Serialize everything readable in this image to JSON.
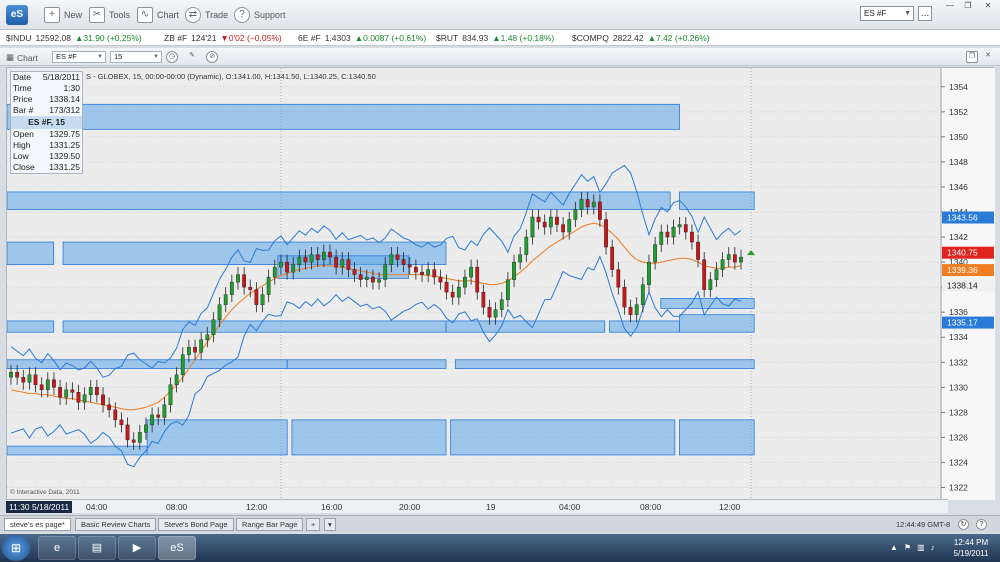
{
  "app": {
    "logo": "eS",
    "toolbar": [
      {
        "label": "New",
        "icon": "new-icon",
        "glyph": "+"
      },
      {
        "label": "Tools",
        "icon": "tools-icon",
        "glyph": "✂"
      },
      {
        "label": "Chart",
        "icon": "chart-icon",
        "glyph": "∿"
      },
      {
        "label": "Trade",
        "icon": "trade-icon",
        "glyph": "⇄"
      },
      {
        "label": "Support",
        "icon": "support-icon",
        "glyph": "?"
      }
    ],
    "symbol_select": "ES #F"
  },
  "ticker": [
    {
      "sym": "$INDU",
      "last": "12592.08",
      "chg": "▲31.90 (+0.25%)",
      "dir": "up"
    },
    {
      "sym": "ZB #F",
      "last": "124'21",
      "chg": "▼0'02 (−0.05%)",
      "dir": "dn"
    },
    {
      "sym": "6E #F",
      "last": "1.4303",
      "chg": "▲0.0087 (+0.61%)",
      "dir": "up"
    },
    {
      "sym": "$RUT",
      "last": "834.93",
      "chg": "▲1.48 (+0.18%)",
      "dir": "up"
    },
    {
      "sym": "$COMPQ",
      "last": "2822.42",
      "chg": "▲7.42 (+0.26%)",
      "dir": "up"
    }
  ],
  "chart_window": {
    "title": "Chart",
    "symbol": "ES #F",
    "interval": "15",
    "description": "S - GLOBEX, 15, 00:00-00:00 (Dynamic), O:1341.00, H:1341.50, L:1340.25, C:1340.50",
    "watermark": "© Interactive Data, 2011"
  },
  "info": {
    "Date": "5/18/2011",
    "Time": "1:30",
    "Price": "1338.14",
    "Bar": "173/312",
    "header": "ES #F, 15",
    "Open": "1329.75",
    "High": "1331.25",
    "Low": "1329.50",
    "Close": "1331.25"
  },
  "chart_data": {
    "type": "candlestick",
    "ylim": [
      1321,
      1355.5
    ],
    "yticks": [
      1322,
      1324,
      1326,
      1328,
      1330,
      1332,
      1334,
      1336,
      1338,
      1340,
      1342,
      1344,
      1346,
      1348,
      1350,
      1352,
      1354
    ],
    "xticks": [
      "04:00",
      "08:00",
      "12:00",
      "16:00",
      "20:00",
      "19",
      "04:00",
      "08:00",
      "12:00"
    ],
    "cursor_time": "11:30 5/18/2011",
    "price_labels": [
      {
        "value": 1343.56,
        "text": "1343.56",
        "color": "#2a7ad8"
      },
      {
        "value": 1340.75,
        "text": "1340.75",
        "color": "#e0241c"
      },
      {
        "value": 1339.36,
        "text": "1339.36",
        "color": "#f07d22"
      },
      {
        "value": 1338.14,
        "text": "1338.14",
        "color": "#f0f0f0"
      },
      {
        "value": 1335.17,
        "text": "1335.17",
        "color": "#2a7ad8"
      }
    ],
    "zones": [
      {
        "x0": 0.0,
        "x1": 0.72,
        "y0": 1350.6,
        "y1": 1352.6
      },
      {
        "x0": 0.0,
        "x1": 0.71,
        "y0": 1344.2,
        "y1": 1345.6
      },
      {
        "x0": 0.72,
        "x1": 0.8,
        "y0": 1344.2,
        "y1": 1345.6
      },
      {
        "x0": 0.0,
        "x1": 0.05,
        "y0": 1339.8,
        "y1": 1341.6
      },
      {
        "x0": 0.06,
        "x1": 0.47,
        "y0": 1339.8,
        "y1": 1341.6
      },
      {
        "x0": 0.29,
        "x1": 0.43,
        "y0": 1338.7,
        "y1": 1340.5
      },
      {
        "x0": 0.7,
        "x1": 0.8,
        "y0": 1336.3,
        "y1": 1337.1
      },
      {
        "x0": 0.0,
        "x1": 0.05,
        "y0": 1334.4,
        "y1": 1335.3
      },
      {
        "x0": 0.06,
        "x1": 0.47,
        "y0": 1334.4,
        "y1": 1335.3
      },
      {
        "x0": 0.47,
        "x1": 0.64,
        "y0": 1334.4,
        "y1": 1335.3
      },
      {
        "x0": 0.645,
        "x1": 0.72,
        "y0": 1334.4,
        "y1": 1335.3
      },
      {
        "x0": 0.72,
        "x1": 0.8,
        "y0": 1334.4,
        "y1": 1335.8
      },
      {
        "x0": 0.0,
        "x1": 0.3,
        "y0": 1331.5,
        "y1": 1332.2
      },
      {
        "x0": 0.3,
        "x1": 0.47,
        "y0": 1331.5,
        "y1": 1332.2
      },
      {
        "x0": 0.48,
        "x1": 0.8,
        "y0": 1331.5,
        "y1": 1332.2
      },
      {
        "x0": 0.15,
        "x1": 0.3,
        "y0": 1324.6,
        "y1": 1327.4
      },
      {
        "x0": 0.305,
        "x1": 0.47,
        "y0": 1324.6,
        "y1": 1327.4
      },
      {
        "x0": 0.475,
        "x1": 0.715,
        "y0": 1324.6,
        "y1": 1327.4
      },
      {
        "x0": 0.72,
        "x1": 0.8,
        "y0": 1324.6,
        "y1": 1327.4
      },
      {
        "x0": 0.0,
        "x1": 0.15,
        "y0": 1324.6,
        "y1": 1325.3
      }
    ],
    "closes": [
      1331.2,
      1330.8,
      1330.4,
      1331.0,
      1330.2,
      1329.8,
      1330.6,
      1330.0,
      1329.2,
      1329.8,
      1329.6,
      1328.8,
      1329.4,
      1330.0,
      1329.4,
      1328.6,
      1328.2,
      1327.4,
      1327.0,
      1325.8,
      1325.6,
      1326.4,
      1327.0,
      1327.8,
      1327.6,
      1328.6,
      1330.2,
      1331.0,
      1332.6,
      1333.2,
      1332.8,
      1333.8,
      1334.2,
      1335.4,
      1336.6,
      1337.4,
      1338.4,
      1339.0,
      1338.0,
      1337.8,
      1336.6,
      1337.4,
      1338.8,
      1339.6,
      1340.0,
      1339.2,
      1339.8,
      1340.4,
      1340.0,
      1340.6,
      1340.2,
      1340.8,
      1340.4,
      1339.6,
      1340.2,
      1339.4,
      1339.0,
      1338.6,
      1338.8,
      1338.4,
      1338.6,
      1339.8,
      1340.6,
      1340.2,
      1339.8,
      1339.6,
      1339.2,
      1339.0,
      1339.4,
      1338.8,
      1338.4,
      1337.6,
      1337.2,
      1338.0,
      1338.8,
      1339.6,
      1337.6,
      1336.4,
      1335.6,
      1336.2,
      1337.0,
      1338.6,
      1340.0,
      1340.6,
      1342.0,
      1343.6,
      1343.2,
      1342.8,
      1343.6,
      1343.0,
      1342.4,
      1343.4,
      1344.2,
      1345.0,
      1344.4,
      1344.8,
      1343.4,
      1341.2,
      1339.4,
      1338.0,
      1336.4,
      1335.8,
      1336.6,
      1338.2,
      1340.0,
      1341.4,
      1342.4,
      1342.0,
      1342.8,
      1343.0,
      1342.4,
      1341.6,
      1340.2,
      1337.8,
      1338.6,
      1339.4,
      1340.2,
      1340.6,
      1340.0,
      1340.4
    ],
    "ma": [
      1329.8,
      1329.7,
      1329.6,
      1329.5,
      1329.5,
      1329.4,
      1329.4,
      1329.3,
      1329.2,
      1329.1,
      1329.1,
      1329.0,
      1328.9,
      1328.8,
      1328.7,
      1328.6,
      1328.5,
      1328.4,
      1328.3,
      1328.2,
      1328.2,
      1328.3,
      1328.4,
      1328.6,
      1328.8,
      1329.2,
      1329.7,
      1330.2,
      1330.8,
      1331.5,
      1332.2,
      1332.9,
      1333.6,
      1334.3,
      1335.0,
      1335.6,
      1336.2,
      1336.7,
      1337.1,
      1337.5,
      1337.8,
      1338.1,
      1338.4,
      1338.7,
      1338.9,
      1339.1,
      1339.3,
      1339.4,
      1339.5,
      1339.6,
      1339.7,
      1339.7,
      1339.7,
      1339.6,
      1339.6,
      1339.5,
      1339.4,
      1339.3,
      1339.2,
      1339.1,
      1339.0,
      1339.0,
      1339.0,
      1339.0,
      1339.0,
      1339.0,
      1339.0,
      1339.0,
      1338.9,
      1338.9,
      1338.8,
      1338.7,
      1338.6,
      1338.5,
      1338.5,
      1338.5,
      1338.4,
      1338.3,
      1338.2,
      1338.2,
      1338.3,
      1338.5,
      1338.8,
      1339.2,
      1339.6,
      1340.1,
      1340.5,
      1340.9,
      1341.3,
      1341.6,
      1341.9,
      1342.2,
      1342.5,
      1342.8,
      1343.0,
      1343.1,
      1343.0,
      1342.7,
      1342.3,
      1341.8,
      1341.2,
      1340.6,
      1340.2,
      1340.0,
      1339.9,
      1339.9,
      1340.0,
      1340.1,
      1340.2,
      1340.3,
      1340.3,
      1340.2,
      1340.0,
      1339.7,
      1339.6,
      1339.5,
      1339.5,
      1339.6,
      1339.6,
      1339.7
    ]
  },
  "time_axis": {
    "cursor": "11:30 5/18/2011"
  },
  "tabs": [
    "steve's es page*",
    "Basic Review Charts",
    "Steve's Bond Page",
    "Range Bar Page"
  ],
  "status": {
    "clock": "12:44:49 GMT-8"
  },
  "taskbar": {
    "time": "12:44 PM",
    "date": "5/19/2011"
  }
}
